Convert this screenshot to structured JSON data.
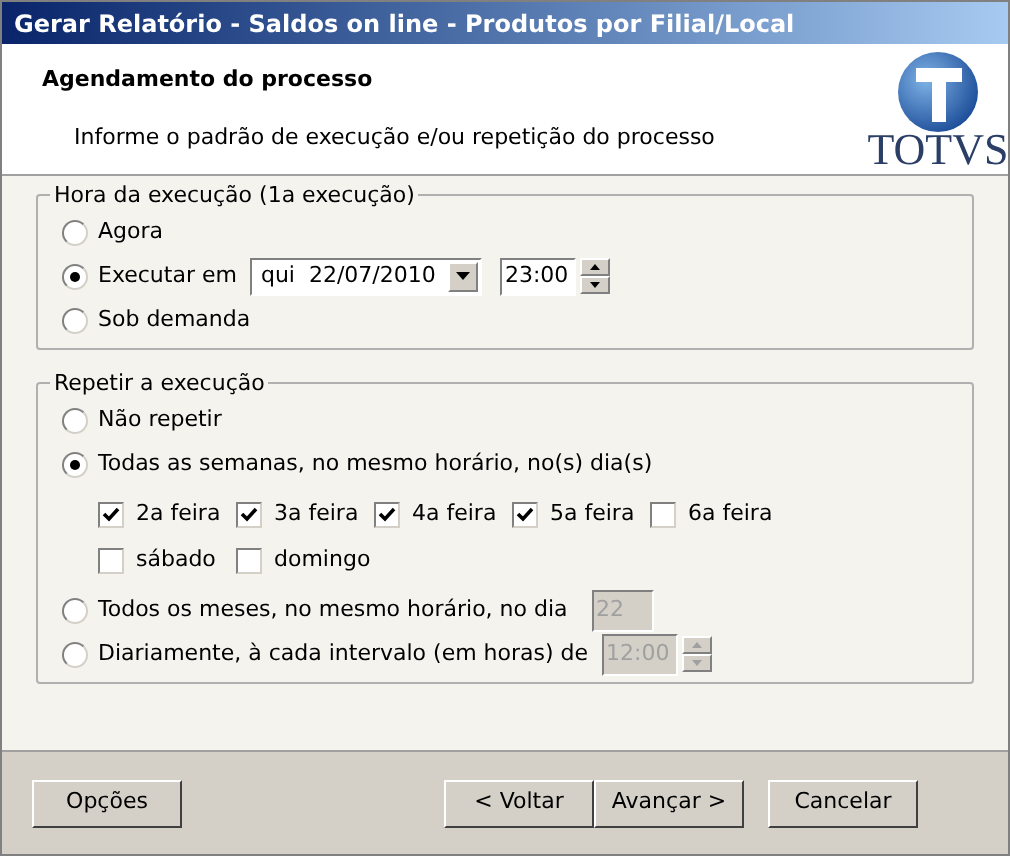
{
  "window": {
    "title": "Gerar Relatório - Saldos on line - Produtos por Filial/Local"
  },
  "header": {
    "title": "Agendamento do processo",
    "subtitle": "Informe o padrão de execução e/ou repetição do processo",
    "logo_text": "TOTVS"
  },
  "schedule": {
    "legend": "Hora da execução (1a execução)",
    "options": [
      {
        "kind": "plain",
        "label": "Agora",
        "selected": false
      },
      {
        "kind": "datetime",
        "label": "Executar em",
        "selected": true,
        "date": "qui  22/07/2010",
        "time": "23:00"
      },
      {
        "kind": "plain",
        "label": "Sob demanda",
        "selected": false
      }
    ]
  },
  "repeat": {
    "legend": "Repetir a execução",
    "options": [
      {
        "kind": "plain",
        "label": "Não repetir",
        "selected": false
      },
      {
        "kind": "weekly",
        "label": "Todas as semanas, no mesmo horário, no(s) dia(s)",
        "selected": true,
        "days": [
          {
            "label": "2a feira",
            "checked": true
          },
          {
            "label": "3a feira",
            "checked": true
          },
          {
            "label": "4a feira",
            "checked": true
          },
          {
            "label": "5a feira",
            "checked": true
          },
          {
            "label": "6a feira",
            "checked": false
          },
          {
            "label": "sábado",
            "checked": false
          },
          {
            "label": "domingo",
            "checked": false
          }
        ]
      },
      {
        "kind": "monthly",
        "label": "Todos os meses, no mesmo horário, no dia",
        "selected": false,
        "value": "22",
        "disabled": true
      },
      {
        "kind": "daily",
        "label": "Diariamente, à cada intervalo (em horas) de",
        "selected": false,
        "value": "12:00",
        "disabled": true
      }
    ]
  },
  "buttons": [
    {
      "label": "Opções",
      "kind": "left"
    },
    {
      "label": "< Voltar",
      "kind": "right"
    },
    {
      "label": "Avançar >",
      "kind": "right"
    },
    {
      "label": "Cancelar",
      "kind": "cancel"
    }
  ]
}
